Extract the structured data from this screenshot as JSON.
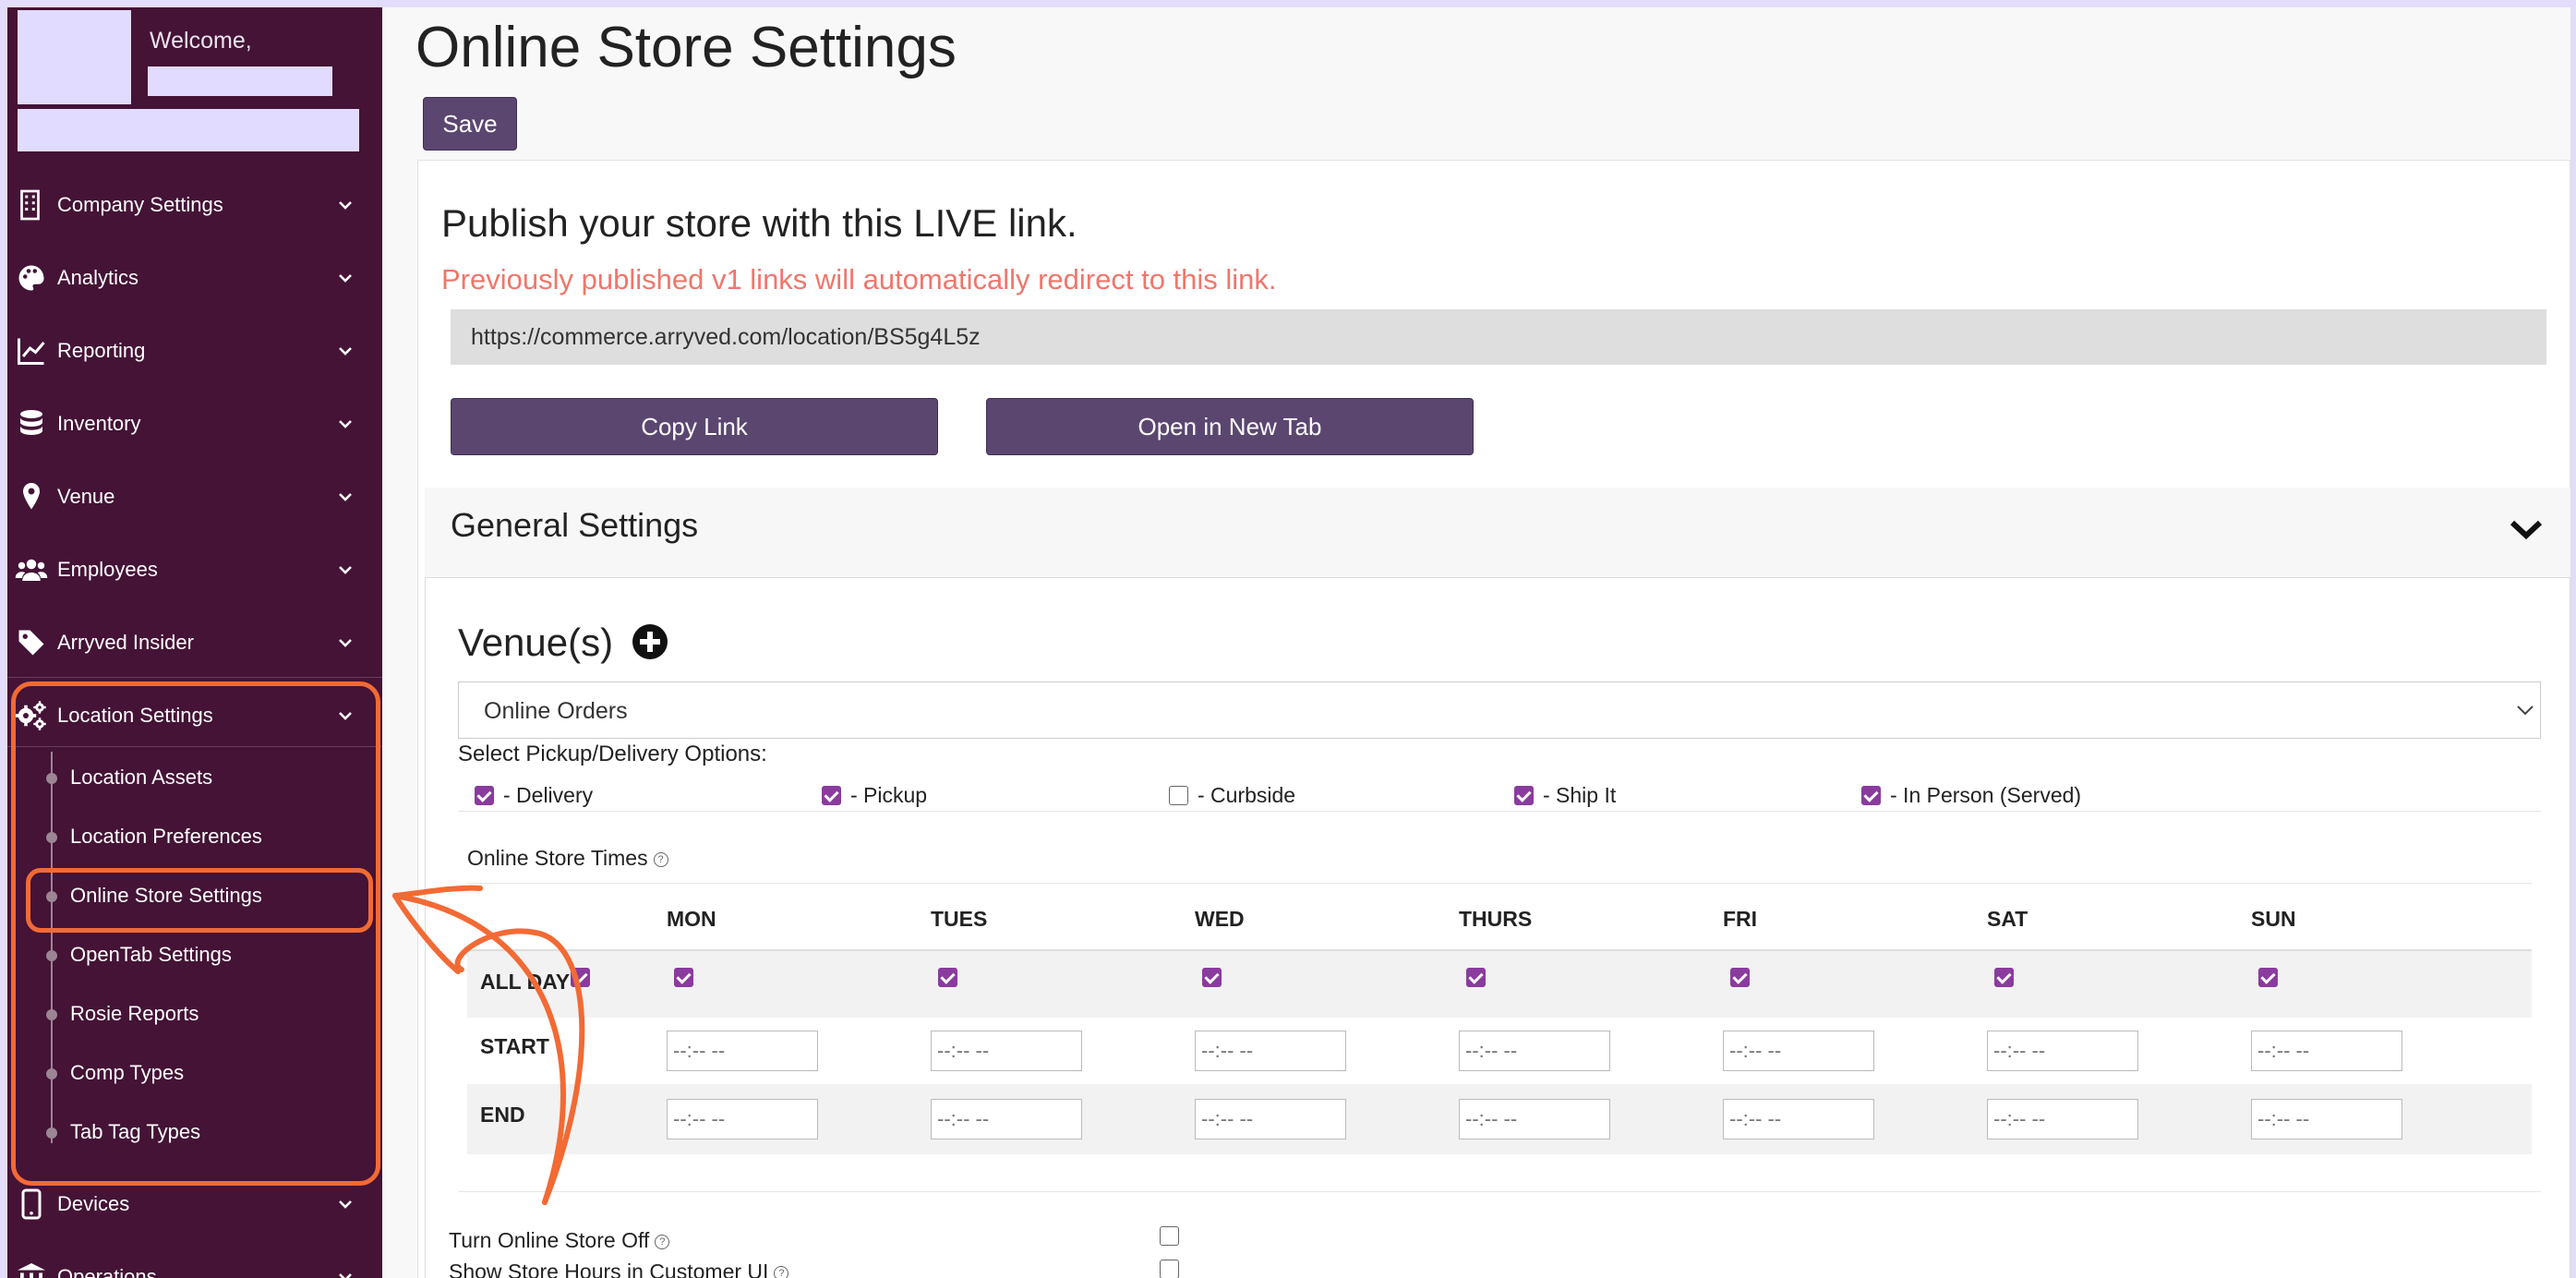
{
  "sidebar": {
    "welcome": "Welcome,",
    "items": [
      {
        "label": "Company Settings",
        "icon": "building-icon"
      },
      {
        "label": "Analytics",
        "icon": "palette-icon"
      },
      {
        "label": "Reporting",
        "icon": "chart-line-icon"
      },
      {
        "label": "Inventory",
        "icon": "database-icon"
      },
      {
        "label": "Venue",
        "icon": "map-pin-icon"
      },
      {
        "label": "Employees",
        "icon": "users-icon"
      },
      {
        "label": "Arryved Insider",
        "icon": "tag-icon"
      },
      {
        "label": "Location Settings",
        "icon": "gears-icon"
      }
    ],
    "location_subitems": [
      "Location Assets",
      "Location Preferences",
      "Online Store Settings",
      "OpenTab Settings",
      "Rosie Reports",
      "Comp Types",
      "Tab Tag Types"
    ],
    "after_items": [
      {
        "label": "Devices",
        "icon": "device-icon"
      },
      {
        "label": "Operations",
        "icon": "bank-icon"
      }
    ]
  },
  "main": {
    "title": "Online Store Settings",
    "save_label": "Save",
    "publish_title": "Publish your store with this LIVE link.",
    "publish_note": "Previously published v1 links will automatically redirect to this link.",
    "live_link": "https://commerce.arryved.com/location/BS5g4L5z",
    "copy_link_label": "Copy Link",
    "open_tab_label": "Open in New Tab"
  },
  "general": {
    "title": "General Settings",
    "venues_title": "Venue(s)",
    "venue_selected": "Online Orders",
    "pickup_title": "Select Pickup/Delivery Options:",
    "options": [
      {
        "label": "- Delivery",
        "checked": true
      },
      {
        "label": "- Pickup",
        "checked": true
      },
      {
        "label": "- Curbside",
        "checked": false
      },
      {
        "label": "- Ship It",
        "checked": true
      },
      {
        "label": "- In Person (Served)",
        "checked": true
      }
    ],
    "times_title": "Online Store Times",
    "days": [
      "MON",
      "TUES",
      "WED",
      "THURS",
      "FRI",
      "SAT",
      "SUN"
    ],
    "row_all_day": "ALL DAY",
    "row_start": "START",
    "row_end": "END",
    "time_placeholder": "--:-- --",
    "turn_off_label": "Turn Online Store Off",
    "show_hours_label": "Show Store Hours in Customer UI"
  },
  "colors": {
    "sidebar_bg": "#441336",
    "accent": "#5b4670",
    "checkbox": "#8a3b9e",
    "note": "#f0766b",
    "highlight": "#f26a34"
  }
}
